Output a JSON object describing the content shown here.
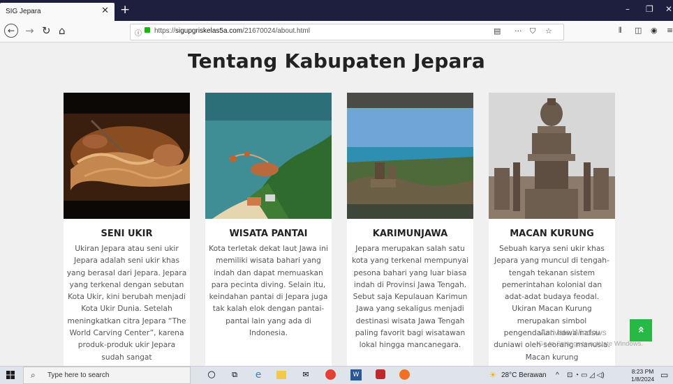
{
  "browser": {
    "tab_title": "SIG Jepara",
    "tab_close": "✕",
    "new_tab": "+",
    "win_min": "–",
    "win_max": "❐",
    "win_close": "✕",
    "url_prefix": "https://",
    "url_domain": "sigupgriskelas5a.com",
    "url_path": "/21670024/about.html",
    "url_more": "···"
  },
  "page": {
    "title": "Tentang Kabupaten Jepara",
    "cards": [
      {
        "title": "SENI UKIR",
        "text": "Ukiran Jepara atau seni ukir Jepara adalah seni ukir khas yang berasal dari Jepara. Jepara yang terkenal dengan sebutan Kota Ukir, kini berubah menjadi Kota Ukir Dunia. Setelah meningkatkan citra Jepara “The World Carving Center”, karena produk-produk ukir Jepara sudah sangat"
      },
      {
        "title": "WISATA PANTAI",
        "text": "Kota terletak dekat laut Jawa ini memiliki wisata bahari yang indah dan dapat memuaskan para pecinta diving. Selain itu, keindahan pantai di Jepara juga tak kalah elok dengan pantai-pantai lain yang ada di Indonesia."
      },
      {
        "title": "KARIMUNJAWA",
        "text": "Jepara merupakan salah satu kota yang terkenal mempunyai pesona bahari yang luar biasa indah di Provinsi Jawa Tengah. Sebut saja Kepulauan Karimun Jawa yang sekaligus menjadi destinasi wisata Jawa Tengah paling favorit bagi wisatawan lokal hingga mancanegara."
      },
      {
        "title": "MACAN KURUNG",
        "text": "Sebuah karya seni ukir khas Jepara  yang muncul di tengah-tengah tekanan sistem pemerintahan  kolonial dan adat-adat  budaya feodal. Ukiran Macan Kurung merupakan simbol pengendalian hawa nafsu duniawi oleh seorang manusia.  Macan kurung"
      }
    ],
    "watermark_title": "Activate Windows",
    "watermark_sub": "Go to Settings to activate Windows.",
    "scroll_top": "»"
  },
  "taskbar": {
    "search_placeholder": "Type here to search",
    "weather": "28°C  Berawan",
    "time": "8:23 PM",
    "date": "1/8/2024"
  },
  "icons": [
    "back-icon",
    "forward-icon",
    "reload-icon",
    "home-icon",
    "info-icon",
    "lock-icon",
    "reader-icon",
    "pocket-icon",
    "bookmark-star-icon",
    "library-icon",
    "sidebar-icon",
    "account-icon",
    "menu-icon",
    "windows-start-icon",
    "search-icon",
    "cortana-icon",
    "task-view-icon",
    "edge-icon",
    "file-explorer-icon",
    "mail-icon",
    "chrome-icon",
    "word-icon",
    "app-icon",
    "firefox-icon",
    "weather-icon"
  ]
}
